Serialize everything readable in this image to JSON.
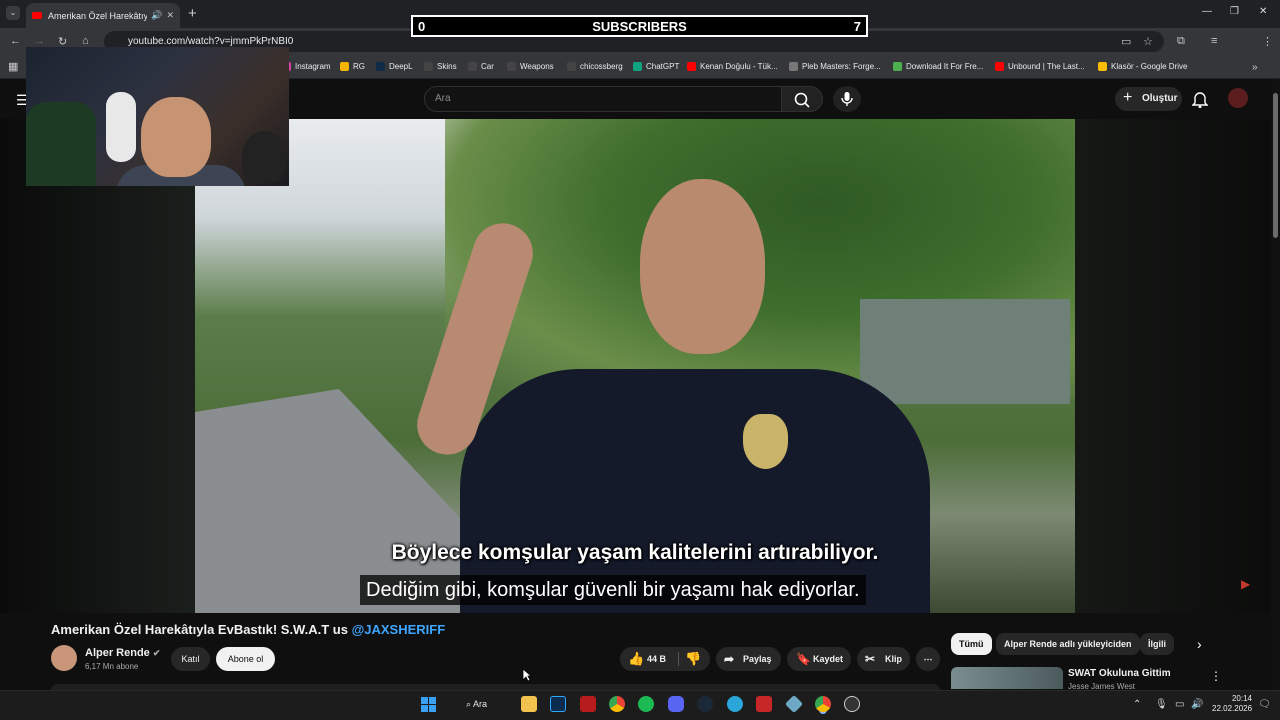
{
  "browser": {
    "tab_title": "Amerikan Özel Harekâtıyla E",
    "url": "youtube.com/watch?v=jmmPkPrNBI0",
    "bookmarks": [
      {
        "label": "Instagram",
        "color": "#d6409f"
      },
      {
        "label": "RG",
        "color": "#f4b400"
      },
      {
        "label": "DeepL",
        "color": "#0f2b46"
      },
      {
        "label": "Skins",
        "color": "#444444"
      },
      {
        "label": "Car",
        "color": "#444444"
      },
      {
        "label": "Weapons",
        "color": "#444444"
      },
      {
        "label": "chicossberg",
        "color": "#444444"
      },
      {
        "label": "ChatGPT",
        "color": "#10a37f"
      },
      {
        "label": "Kenan Doğulu - Tük...",
        "color": "#ff0000"
      },
      {
        "label": "Pleb Masters: Forge...",
        "color": "#777777"
      },
      {
        "label": "Download It For Fre...",
        "color": "#4caf50"
      },
      {
        "label": "Unbound | The Last...",
        "color": "#ff0000"
      },
      {
        "label": "Klasör - Google Drive",
        "color": "#fbbc04"
      }
    ]
  },
  "overlay": {
    "left_count": "0",
    "label": "SUBSCRIBERS",
    "right_count": "7"
  },
  "youtube": {
    "search_placeholder": "Ara",
    "create_label": "Oluştur"
  },
  "video": {
    "subtitle_line1": "Böylece komşular yaşam kalitelerini artırabiliyor.",
    "subtitle_line2": "Dediğim gibi, komşular güvenli bir yaşamı hak ediyorlar.",
    "title_main": "Amerikan Özel Harekâtıyla EvBastık! S.W.A.T us ",
    "title_mention": "@JAXSHERIFF",
    "channel_name": "Alper Rende",
    "channel_subs": "6,17 Mn abone",
    "join_label": "Katıl",
    "subscribe_label": "Abone ol",
    "likes": "44 B",
    "share_label": "Paylaş",
    "save_label": "Kaydet",
    "clip_label": "Klip"
  },
  "recommendations": {
    "chips": [
      "Tümü",
      "Alper Rende adlı yükleyiciden",
      "İlgili"
    ],
    "first_title": "SWAT Okuluna Gittim",
    "first_channel": "Jesse James West"
  },
  "taskbar": {
    "search_label": "Ara",
    "time": "20:14",
    "date": "22.02.2026"
  }
}
